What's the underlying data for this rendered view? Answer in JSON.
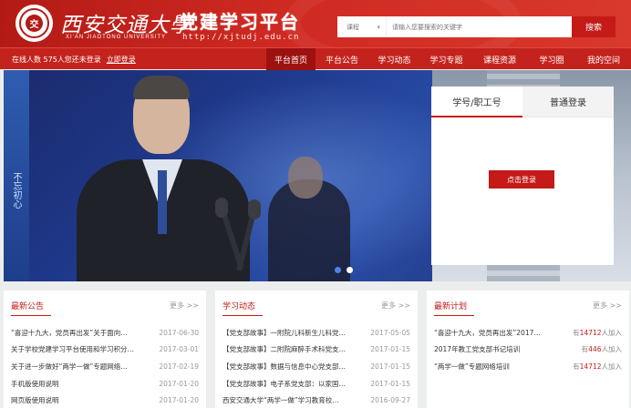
{
  "header": {
    "seal_char": "交",
    "univ_cn": "西安交通大學",
    "univ_en": "XI'AN JIAOTONG UNIVERSITY",
    "title": "党建学习平台",
    "url": "http://xjtudj.edu.cn"
  },
  "search": {
    "category": "课程",
    "placeholder": "请输入您要搜索的关键字",
    "button": "搜索"
  },
  "topbar": {
    "online_text": "在线人数 575人您还未登录",
    "login_link": "立即登录"
  },
  "nav": {
    "items": [
      {
        "label": "平台首页",
        "active": true
      },
      {
        "label": "平台公告",
        "active": false
      },
      {
        "label": "学习动态",
        "active": false
      },
      {
        "label": "学习专题",
        "active": false
      },
      {
        "label": "课程资源",
        "active": false
      },
      {
        "label": "学习圈",
        "active": false
      },
      {
        "label": "我的空间",
        "active": false
      }
    ]
  },
  "banner": {
    "flag_text": "不忘初心"
  },
  "login": {
    "tab_account": "学号/职工号",
    "tab_normal": "普通登录",
    "button": "点击登录"
  },
  "panels": {
    "notices": {
      "title": "最新公告",
      "more": "更多 >>",
      "rows": [
        {
          "title": "“喜迎十九大，党员再出发”关于面向…",
          "date": "2017-06-30"
        },
        {
          "title": "关于学校党建学习平台使用和学习积分…",
          "date": "2017-03-01"
        },
        {
          "title": "关于进一步做好“两学一做”专题网络…",
          "date": "2017-02-19"
        },
        {
          "title": "手机版使用说明",
          "date": "2017-01-20"
        },
        {
          "title": "网页版使用说明",
          "date": "2017-01-20"
        }
      ]
    },
    "news": {
      "title": "学习动态",
      "more": "更多 >>",
      "rows": [
        {
          "title": "【党支部故事】一附院儿科新生儿科党…",
          "date": "2017-05-05"
        },
        {
          "title": "【党支部故事】二附院麻醉手术科党支…",
          "date": "2017-01-15"
        },
        {
          "title": "【党支部故事】数据与信息中心党支部…",
          "date": "2017-01-15"
        },
        {
          "title": "【党支部故事】电子系党支部：以家国…",
          "date": "2017-01-15"
        },
        {
          "title": "西安交通大学“两学一做”学习教育校…",
          "date": "2016-09-27"
        }
      ]
    },
    "plans": {
      "title": "最新计划",
      "more": "更多 >>",
      "prefix": "有",
      "suffix": "人加入",
      "rows": [
        {
          "title": "“喜迎十九大，党员再出发”2017…",
          "count": "14712"
        },
        {
          "title": "2017年教工党支部书记培训",
          "count": "446"
        },
        {
          "title": "“两学一做”专题网络培训",
          "count": "14712"
        }
      ]
    }
  },
  "colors": {
    "brand_red": "#c41a18",
    "nav_active": "#9d1210",
    "banner_blue": "#1f3a8e"
  }
}
